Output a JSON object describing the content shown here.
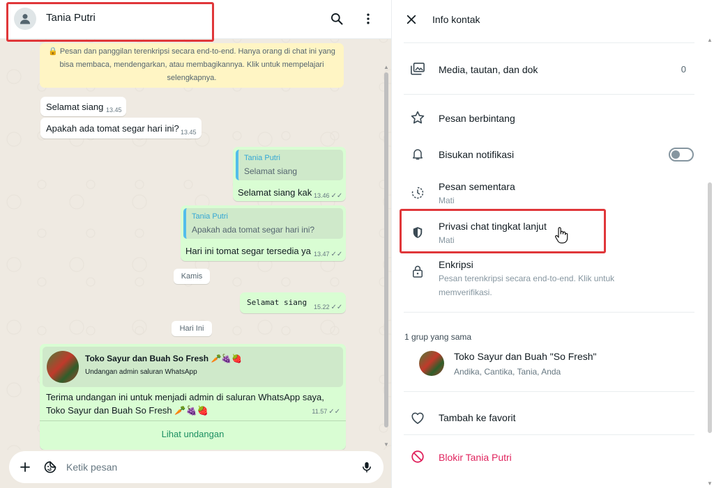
{
  "chat": {
    "contact_name": "Tania Putri",
    "encryption_notice": "🔒 Pesan dan panggilan terenkripsi secara end-to-end. Hanya orang di chat ini yang bisa membaca, mendengarkan, atau membagikannya. Klik untuk mempelajari selengkapnya.",
    "messages": [
      {
        "text": "Selamat siang",
        "time": "13.45"
      },
      {
        "text": "Apakah ada tomat segar hari ini?",
        "time": "13.45"
      },
      {
        "quote_name": "Tania Putri",
        "quote_text": "Selamat siang",
        "text": "Selamat siang kak",
        "time": "13.46"
      },
      {
        "quote_name": "Tania Putri",
        "quote_text": "Apakah ada tomat segar hari ini?",
        "text": "Hari ini tomat segar tersedia ya",
        "time": "13.47"
      },
      {
        "text": "Selamat siang",
        "time": "15.22"
      }
    ],
    "date_chips": [
      "Kamis",
      "Hari Ini"
    ],
    "invite": {
      "title": "Toko Sayur dan Buah So Fresh 🥕🍇🍓",
      "subtitle": "Undangan admin saluran WhatsApp",
      "body": "Terima undangan ini untuk menjadi admin di saluran WhatsApp saya, Toko Sayur dan Buah So Fresh 🥕🍇🍓",
      "time": "11.57",
      "action_label": "Lihat undangan"
    },
    "composer_placeholder": "Ketik pesan"
  },
  "info": {
    "title": "Info kontak",
    "media_label": "Media, tautan, dan dok",
    "media_count": "0",
    "starred_label": "Pesan berbintang",
    "mute_label": "Bisukan notifikasi",
    "mute_enabled": false,
    "disappearing_label": "Pesan sementara",
    "disappearing_value": "Mati",
    "privacy_label": "Privasi chat tingkat lanjut",
    "privacy_value": "Mati",
    "encryption_label": "Enkripsi",
    "encryption_sub": "Pesan terenkripsi secara end-to-end. Klik untuk memverifikasi.",
    "groups_caption": "1 grup yang sama",
    "group_name": "Toko Sayur dan Buah \"So Fresh\"",
    "group_members": "Andika, Cantika, Tania, Anda",
    "favorite_label": "Tambah ke favorit",
    "block_label": "Blokir Tania Putri"
  },
  "colors": {
    "accent_green": "#1d8f62",
    "outgoing_bubble": "#d9fdd3",
    "danger": "#e0245e",
    "highlight": "#e0373a"
  }
}
